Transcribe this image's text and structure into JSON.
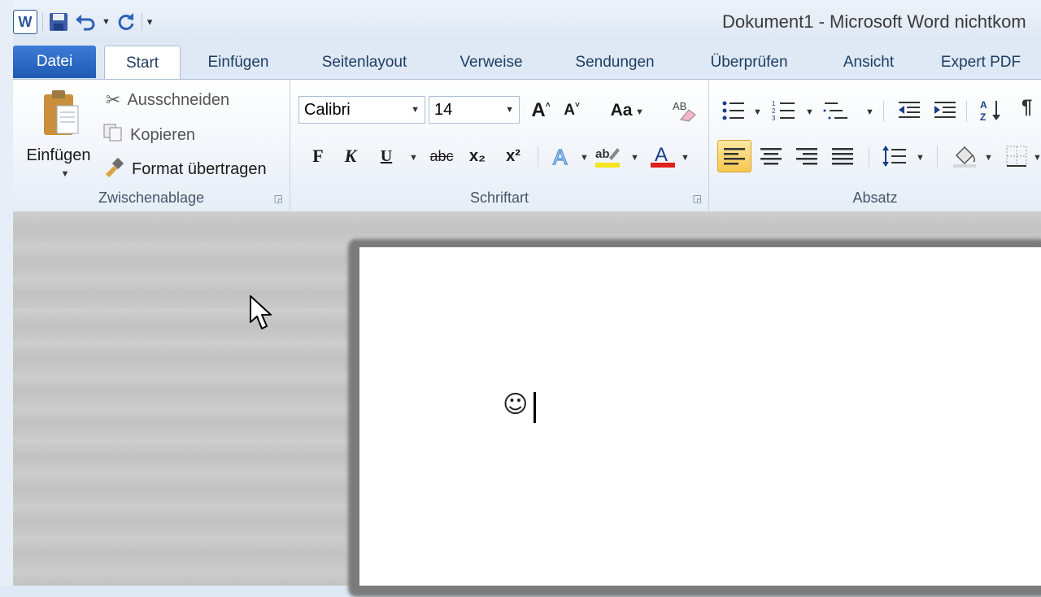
{
  "window": {
    "title": "Dokument1  -  Microsoft Word nichtkom"
  },
  "quick_access": {
    "icons": [
      "word-logo-icon",
      "save-icon",
      "undo-icon",
      "redo-icon",
      "customize-icon"
    ]
  },
  "tabs": [
    {
      "label": "Datei"
    },
    {
      "label": "Start"
    },
    {
      "label": "Einfügen"
    },
    {
      "label": "Seitenlayout"
    },
    {
      "label": "Verweise"
    },
    {
      "label": "Sendungen"
    },
    {
      "label": "Überprüfen"
    },
    {
      "label": "Ansicht"
    },
    {
      "label": "Expert PDF"
    }
  ],
  "clipboard": {
    "paste_label": "Einfügen",
    "cut_label": "Ausschneiden",
    "copy_label": "Kopieren",
    "format_painter_label": "Format übertragen",
    "group_label": "Zwischenablage"
  },
  "font": {
    "font_name": "Calibri",
    "font_size": "14",
    "bold": "F",
    "italic": "K",
    "underline": "U",
    "strikethrough": "abc",
    "subscript": "x₂",
    "superscript": "x²",
    "change_case": "Aa",
    "grow": "A",
    "shrink": "A",
    "group_label": "Schriftart"
  },
  "paragraph": {
    "group_label": "Absatz",
    "active_alignment": "left"
  },
  "document": {
    "content": "☺"
  },
  "colors": {
    "file_tab": "#2a66c2",
    "highlight": "#f5e320",
    "font_color": "#e0201b",
    "active_button": "#f7c74d"
  }
}
